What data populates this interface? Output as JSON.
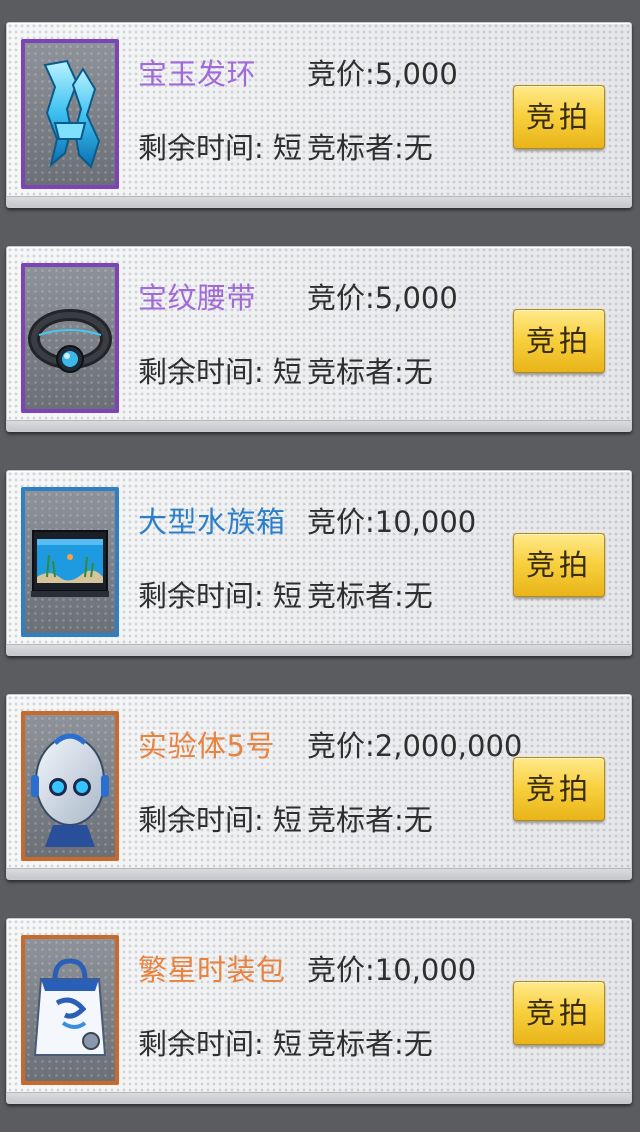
{
  "labels": {
    "price_prefix": "竞价:",
    "time_prefix": "剩余时间:",
    "bidder_prefix": "竞标者:"
  },
  "items": [
    {
      "name": "宝玉发环",
      "name_color": "#a06ad8",
      "frame_color": "#7b45b8",
      "icon": "crystal-headband-icon",
      "price_label": "竞价:5,000",
      "time_label": "剩余时间: 短",
      "bidder_label": "竞标者:无",
      "button_label": "竞拍"
    },
    {
      "name": "宝纹腰带",
      "name_color": "#a06ad8",
      "frame_color": "#7b45b8",
      "icon": "gem-belt-icon",
      "price_label": "竞价:5,000",
      "time_label": "剩余时间: 短",
      "bidder_label": "竞标者:无",
      "button_label": "竞拍"
    },
    {
      "name": "大型水族箱",
      "name_color": "#2e7fc8",
      "frame_color": "#2f7fc4",
      "icon": "aquarium-icon",
      "price_label": "竞价:10,000",
      "time_label": "剩余时间: 短",
      "bidder_label": "竞标者:无",
      "button_label": "竞拍"
    },
    {
      "name": "实验体5号",
      "name_color": "#e8823f",
      "frame_color": "#c76a2e",
      "icon": "robot-head-icon",
      "price_label": "竞价:2,000,000",
      "time_label": "剩余时间: 短",
      "bidder_label": "竞标者:无",
      "button_label": "竞拍"
    },
    {
      "name": "繁星时装包",
      "name_color": "#e8823f",
      "frame_color": "#c76a2e",
      "icon": "outfit-bag-icon",
      "price_label": "竞价:10,000",
      "time_label": "剩余时间: 短",
      "bidder_label": "竞标者:无",
      "button_label": "竞拍"
    }
  ]
}
